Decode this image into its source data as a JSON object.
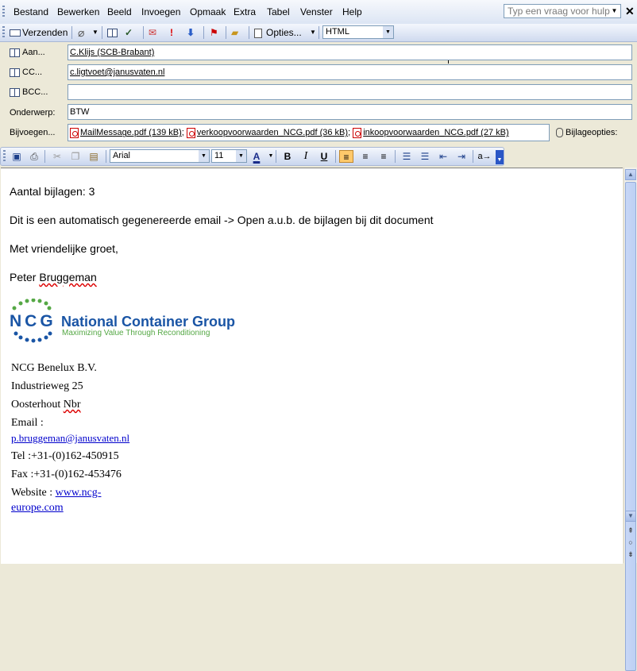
{
  "menu": {
    "items": [
      "Bestand",
      "Bewerken",
      "Beeld",
      "Invoegen",
      "Opmaak",
      "Extra",
      "Tabel",
      "Venster",
      "Help"
    ],
    "help_placeholder": "Typ een vraag voor hulp"
  },
  "toolbar": {
    "send_label": "Verzenden",
    "options_label": "Opties...",
    "format_value": "HTML"
  },
  "header": {
    "to_label": "Aan...",
    "to_value": "C.Klijs (SCB-Brabant)",
    "cc_label": "CC...",
    "cc_value": "c.ligtvoet@janusvaten.nl",
    "bcc_label": "BCC...",
    "bcc_value": "",
    "subject_label": "Onderwerp:",
    "subject_value": "BTW",
    "attach_label": "Bijvoegen...",
    "attachments": [
      "MailMessage.pdf (139 kB)",
      "verkoopvoorwaarden_NCG.pdf (36 kB)",
      "inkoopvoorwaarden_NCG.pdf (27 kB)"
    ],
    "attach_options_label": "Bijlageopties:"
  },
  "formatting": {
    "font": "Arial",
    "size": "11"
  },
  "body": {
    "line1": "Aantal bijlagen: 3",
    "line2": "Dit is een automatisch gegenereerde email -> Open a.u.b. de bijlagen bij dit document",
    "line3": "Met vriendelijke groet,",
    "name_first": "Peter",
    "name_last": "Bruggeman"
  },
  "logo": {
    "ncg": "NCG",
    "name": "National Container Group",
    "tagline": "Maximizing Value Through Reconditioning"
  },
  "signature": {
    "company": "NCG Benelux B.V.",
    "street": "Industrieweg 25",
    "city_prefix": "Oosterhout",
    "city_suffix": "Nbr",
    "email_label": "Email :",
    "email": "p.bruggeman@janusvaten.nl",
    "tel": "Tel :+31-(0)162-450915",
    "fax": "Fax :+31-(0)162-453476",
    "website_label": "Website :",
    "website_line1": "www.ncg-",
    "website_line2": "europe.com"
  }
}
